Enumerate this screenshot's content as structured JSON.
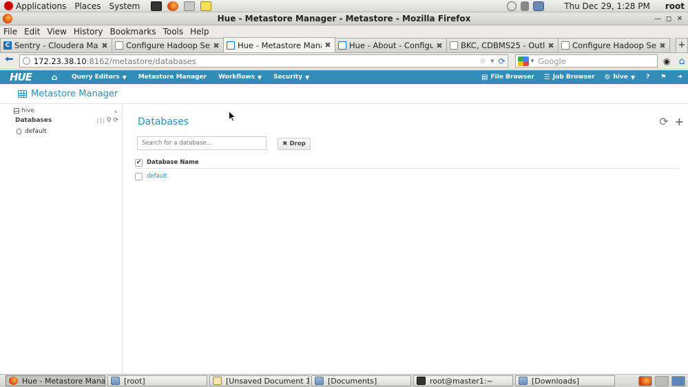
{
  "panel": {
    "menus": [
      "Applications",
      "Places",
      "System"
    ],
    "datetime": "Thu Dec 29,  1:28 PM",
    "user": "root"
  },
  "window": {
    "title": "Hue - Metastore Manager - Metastore - Mozilla Firefox"
  },
  "menubar": {
    "items": [
      "File",
      "Edit",
      "View",
      "History",
      "Bookmarks",
      "Tools",
      "Help"
    ]
  },
  "tabs": [
    {
      "label": "Sentry - Cloudera Mana...",
      "favicon": "cloudera-icon",
      "active": false
    },
    {
      "label": "Configure Hadoop Secur...",
      "favicon": "page-icon",
      "active": false
    },
    {
      "label": "Hue - Metastore Manag...",
      "favicon": "hue-icon",
      "active": true
    },
    {
      "label": "Hue - About - Configurat...",
      "favicon": "hue-icon",
      "active": false
    },
    {
      "label": "BKC, CDBMS25 - Outloo...",
      "favicon": "page-icon",
      "active": false
    },
    {
      "label": "Configure Hadoop Secur...",
      "favicon": "page-icon",
      "active": false
    }
  ],
  "navbar": {
    "url_host": "172.23.38.10",
    "url_path": ":8162/metastore/databases",
    "search_placeholder": "Google"
  },
  "hue": {
    "logo": "HUE",
    "menus": [
      "Query Editors",
      "Metastore Manager",
      "Workflows",
      "Security"
    ],
    "right": {
      "file_browser": "File Browser",
      "job_browser": "Job Browser",
      "user": "hive"
    }
  },
  "page": {
    "title": "Metastore Manager"
  },
  "sidebar": {
    "server": "hive",
    "databases_label": "Databases",
    "count": "(1)",
    "items": [
      "default"
    ]
  },
  "main": {
    "heading": "Databases",
    "search_placeholder": "Search for a database...",
    "drop_label": "Drop",
    "column_header": "Database Name",
    "rows": [
      "default"
    ]
  },
  "taskbar": {
    "items": [
      {
        "label": "Hue - Metastore Mana...",
        "icon": "firefox-icon",
        "active": true
      },
      {
        "label": "[root]",
        "icon": "folder-icon",
        "active": false
      },
      {
        "label": "[Unsaved Document 1...",
        "icon": "text-editor-icon",
        "active": false
      },
      {
        "label": "[Documents]",
        "icon": "folder-icon",
        "active": false
      },
      {
        "label": "root@master1:~",
        "icon": "terminal-icon",
        "active": false
      },
      {
        "label": "[Downloads]",
        "icon": "folder-icon",
        "active": false
      }
    ]
  },
  "colors": {
    "hue_blue": "#338bb8",
    "link_blue": "#338bb8"
  }
}
